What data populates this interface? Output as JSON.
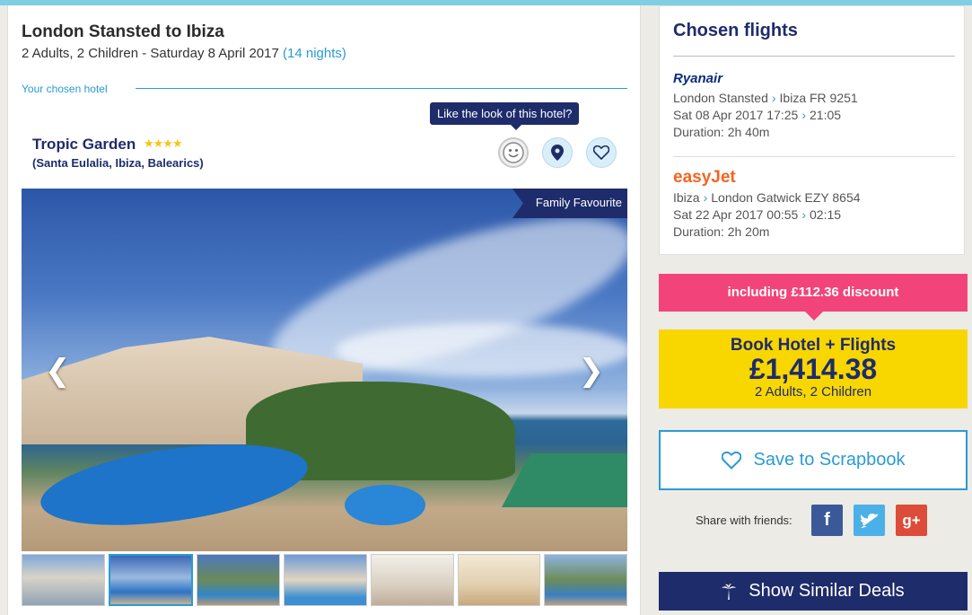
{
  "search": {
    "route_title": "London Stansted to Ibiza",
    "summary": "2 Adults, 2 Children - Saturday 8 April 2017",
    "nights": "(14 nights)"
  },
  "hotel": {
    "section_label": "Your chosen hotel",
    "name": "Tropic Garden",
    "stars": "★★★★",
    "location": "(Santa Eulalia, Ibiza, Balearics)",
    "tooltip": "Like the look of this hotel?",
    "badge": "Family Favourite",
    "thumbnail_count": 7,
    "active_thumbnail": 2
  },
  "flights": {
    "title": "Chosen flights",
    "outbound": {
      "airline": "Ryanair",
      "from": "London Stansted",
      "to_flight": "Ibiza FR 9251",
      "depart": "Sat 08 Apr 2017 17:25",
      "arrive": "21:05",
      "duration": "Duration: 2h 40m"
    },
    "inbound": {
      "airline": "easyJet",
      "from": "Ibiza",
      "to_flight": "London Gatwick EZY 8654",
      "depart": "Sat 22 Apr 2017 00:55",
      "arrive": "02:15",
      "duration": "Duration: 2h 20m"
    }
  },
  "pricing": {
    "discount": "including £112.36 discount",
    "book_title": "Book Hotel + Flights",
    "price": "£1,414.38",
    "pax": "2 Adults, 2 Children"
  },
  "actions": {
    "scrapbook": "Save to Scrapbook",
    "share_label": "Share with friends:",
    "similar": "Show Similar Deals"
  },
  "colors": {
    "navy": "#1e2c6b",
    "accent_blue": "#2a9bd4",
    "discount_pink": "#f2447a",
    "book_yellow": "#f8d600"
  },
  "icons": [
    "smiley-icon",
    "map-pin-icon",
    "heart-icon",
    "facebook-icon",
    "twitter-icon",
    "google-plus-icon",
    "palm-tree-icon"
  ]
}
